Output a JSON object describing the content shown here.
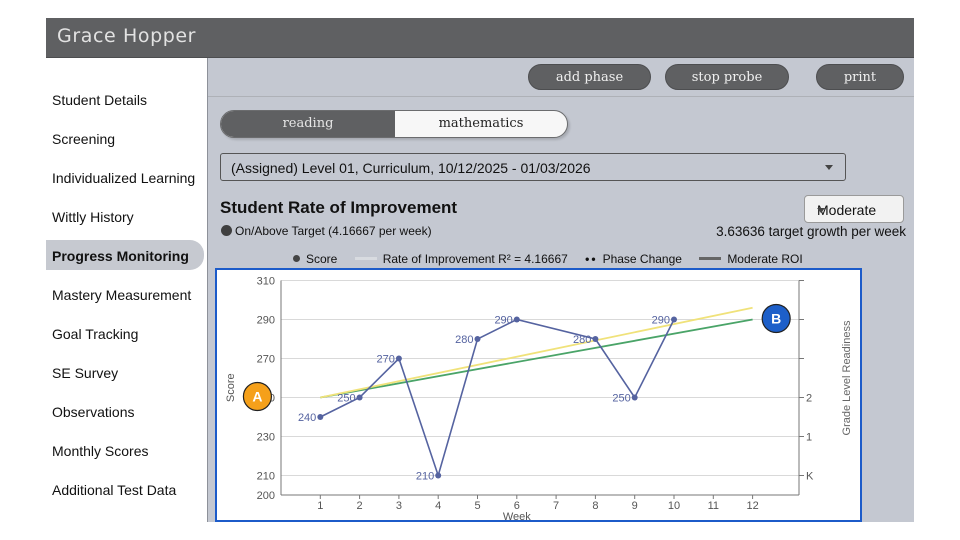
{
  "app": {
    "title": "Grace Hopper"
  },
  "sidebar": {
    "items": [
      {
        "label": "Student Details",
        "active": false
      },
      {
        "label": "Screening",
        "active": false
      },
      {
        "label": "Individualized Learning",
        "active": false
      },
      {
        "label": "Wittly History",
        "active": false
      },
      {
        "label": "Progress Monitoring",
        "active": true
      },
      {
        "label": "Mastery Measurement",
        "active": false
      },
      {
        "label": "Goal Tracking",
        "active": false
      },
      {
        "label": "SE Survey",
        "active": false
      },
      {
        "label": "Observations",
        "active": false
      },
      {
        "label": "Monthly Scores",
        "active": false
      },
      {
        "label": "Additional Test Data",
        "active": false
      }
    ]
  },
  "toolbar": {
    "add_phase": "add phase",
    "stop_probe": "stop probe",
    "print": "print"
  },
  "subject_tabs": {
    "selected": "reading",
    "other": "mathematics"
  },
  "assignment_select": {
    "value": "(Assigned) Level 01, Curriculum, 10/12/2025 - 01/03/2026"
  },
  "roi": {
    "title": "Student Rate of Improvement",
    "status": "On/Above Target (4.16667 per week)",
    "target_growth": "3.63636 target growth per week",
    "rate_dropdown": "Moderate"
  },
  "legend": {
    "score": "Score",
    "roi": "Rate of Improvement R² = 4.16667",
    "phase": "Phase Change",
    "moderate": "Moderate ROI"
  },
  "colors": {
    "score_line": "#5563a0",
    "roi_line": "#f0e27a",
    "moderate_line": "#4aa468",
    "marker_a": "#f5a01a",
    "marker_b": "#1d5fc9",
    "frame": "#1c5bc9"
  },
  "chart_data": {
    "type": "line",
    "xlabel": "Week",
    "ylabel": "Score",
    "y2label": "Grade Level Readiness",
    "xlim": [
      0,
      12
    ],
    "ylim": [
      200,
      310
    ],
    "x_ticks": [
      "1",
      "2",
      "3",
      "4",
      "5",
      "6",
      "7",
      "8",
      "9",
      "10",
      "11",
      "12"
    ],
    "y_ticks": [
      "200",
      "210",
      "230",
      "250",
      "270",
      "290",
      "310"
    ],
    "y2_ticks": [
      {
        "label": "K",
        "value": 210
      },
      {
        "label": "1",
        "value": 230
      },
      {
        "label": "2",
        "value": 250
      }
    ],
    "series": [
      {
        "name": "Score",
        "x": [
          1,
          2,
          3,
          4,
          5,
          6,
          8,
          9,
          10
        ],
        "y": [
          240,
          250,
          270,
          210,
          280,
          290,
          280,
          250,
          290
        ],
        "labels": [
          "240",
          "250",
          "270",
          "210",
          "280",
          "290",
          "280",
          "250",
          "290"
        ]
      }
    ],
    "roi_line": {
      "x": [
        1,
        12
      ],
      "y": [
        250,
        296
      ]
    },
    "moderate_line": {
      "x": [
        1,
        12
      ],
      "y": [
        250,
        290
      ]
    },
    "markers": [
      {
        "label": "A",
        "x": -0.6,
        "y": 250
      },
      {
        "label": "B",
        "x": 12.6,
        "y": 290
      }
    ]
  }
}
